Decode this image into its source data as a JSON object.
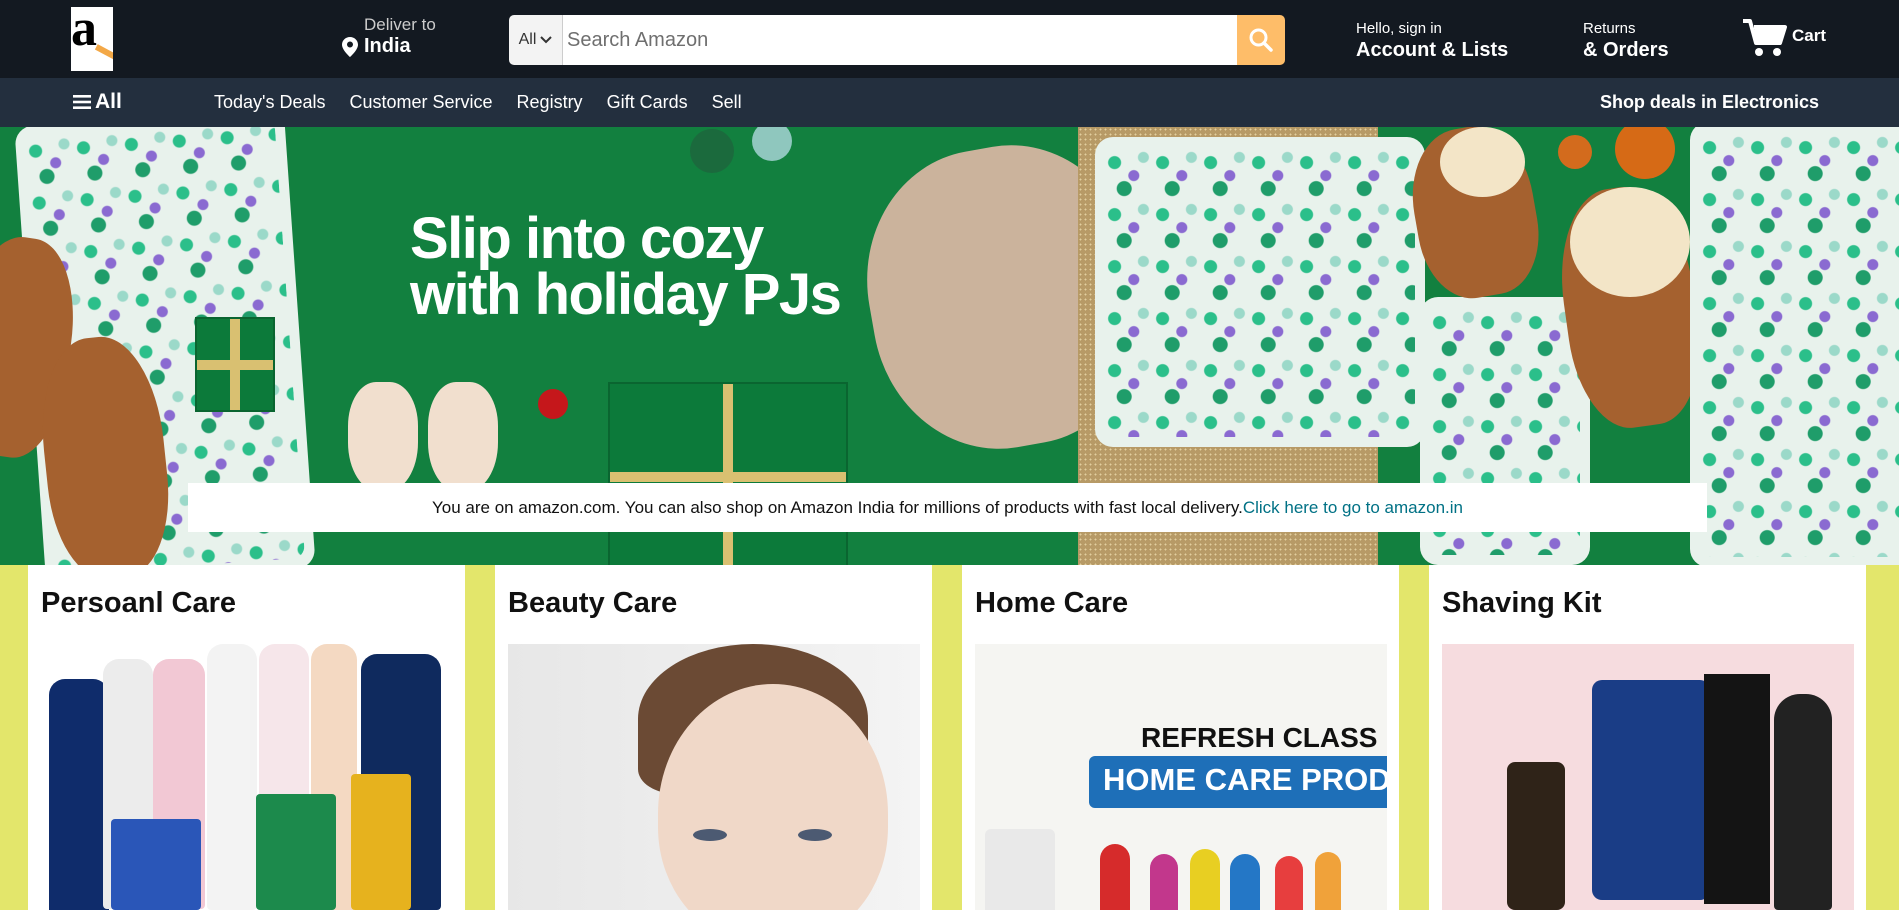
{
  "header": {
    "deliver_label": "Deliver to",
    "deliver_location": "India",
    "search_category": "All",
    "search_placeholder": "Search Amazon",
    "account_greeting": "Hello, sign in",
    "account_label": "Account & Lists",
    "returns_label": "Returns",
    "orders_label": "& Orders",
    "cart_label": "Cart"
  },
  "subnav": {
    "all_label": "All",
    "links": [
      "Today's Deals",
      "Customer Service",
      "Registry",
      "Gift Cards",
      "Sell"
    ],
    "promo": "Shop deals in Electronics"
  },
  "hero": {
    "title_line1": "Slip into cozy",
    "title_line2": "with holiday PJs",
    "notice_text": "You are on amazon.com. You can also shop on Amazon India for millions of products with fast local delivery.",
    "notice_link": "Click here to go to amazon.in"
  },
  "cards": [
    {
      "title": "Persoanl Care"
    },
    {
      "title": "Beauty Care"
    },
    {
      "title": "Home Care",
      "image_text1": "REFRESH CLASS",
      "image_text2": "HOME CARE PROD"
    },
    {
      "title": "Shaving Kit"
    }
  ],
  "icons": [
    "location-pin-icon",
    "chevron-down-icon",
    "search-icon",
    "cart-icon",
    "hamburger-menu-icon"
  ],
  "colors": {
    "topbar": "#131921",
    "subnav": "#232f3e",
    "search_button": "#febd69",
    "hero_green": "#12803f",
    "cards_background": "#e3e66b",
    "link": "#007185"
  }
}
